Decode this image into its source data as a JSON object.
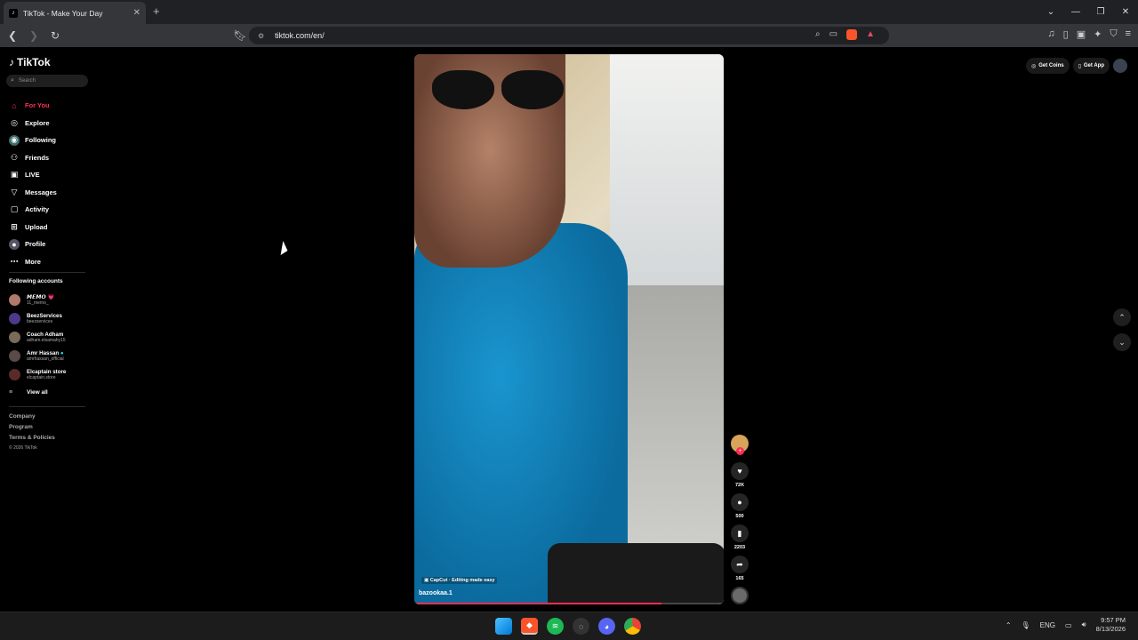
{
  "browser": {
    "tab_title": "TikTok - Make Your Day",
    "tab_close": "✕",
    "new_tab": "+",
    "url": "tiktok.com/en/",
    "window_controls": [
      "⌄",
      "—",
      "❐",
      "✕"
    ]
  },
  "sidebar": {
    "logo": "TikTok",
    "search_placeholder": "Search",
    "menu": [
      {
        "label": "For You",
        "icon": "home-icon",
        "active": true
      },
      {
        "label": "Explore",
        "icon": "compass-icon"
      },
      {
        "label": "Following",
        "icon": "following-icon"
      },
      {
        "label": "Friends",
        "icon": "friends-icon"
      },
      {
        "label": "LIVE",
        "icon": "live-icon"
      },
      {
        "label": "Messages",
        "icon": "messages-icon"
      },
      {
        "label": "Activity",
        "icon": "activity-icon"
      },
      {
        "label": "Upload",
        "icon": "upload-icon"
      },
      {
        "label": "Profile",
        "icon": "profile-icon"
      },
      {
        "label": "More",
        "icon": "more-icon"
      }
    ],
    "following_title": "Following accounts",
    "accounts": [
      {
        "name": "𝙈𝙀𝙈𝙊 💗",
        "handle": "11_memo_"
      },
      {
        "name": "BeezServices",
        "handle": "beezservices"
      },
      {
        "name": "Coach Adham",
        "handle": "adham.elsamahy15"
      },
      {
        "name": "Amr Hassan",
        "handle": "amrhassan_official"
      },
      {
        "name": "Elcaptain store",
        "handle": "elcaptain.store"
      }
    ],
    "view_all": "View all",
    "footer": [
      "Company",
      "Program",
      "Terms & Policies"
    ],
    "copyright": "© 2026 TikTok"
  },
  "video": {
    "capcut_tag": "CapCut · Editing made easy",
    "username": "bazookaa.1",
    "progress": 0.8
  },
  "actions": {
    "likes": "72K",
    "comments": "500",
    "saves": "2203",
    "shares": "165"
  },
  "top_right": {
    "get_coins": "Get Coins",
    "get_app": "Get App"
  },
  "taskbar": {
    "lang": "ENG",
    "time": "9:57 PM",
    "date": "8/13/2026"
  },
  "colors": {
    "accent": "#fe2c55",
    "background": "#000000"
  }
}
